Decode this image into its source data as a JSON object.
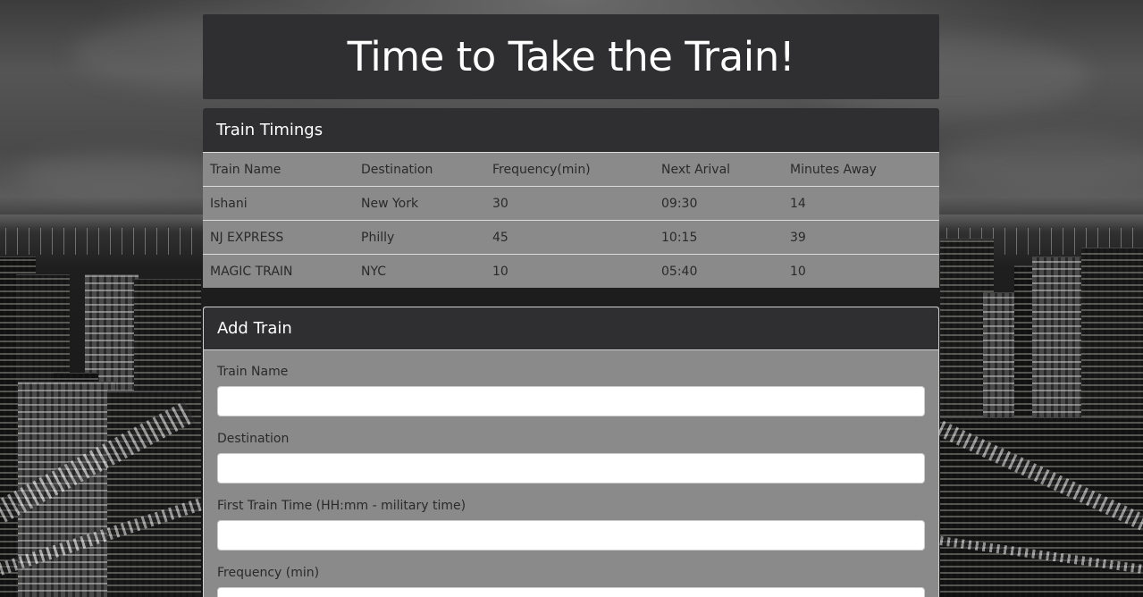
{
  "header": {
    "title": "Time to Take the Train!"
  },
  "timings_panel": {
    "title": "Train Timings",
    "columns": [
      "Train Name",
      "Destination",
      "Frequency(min)",
      "Next Arival",
      "Minutes Away"
    ],
    "rows": [
      [
        "Ishani",
        "New York",
        "30",
        "09:30",
        "14"
      ],
      [
        "NJ EXPRESS",
        "Philly",
        "45",
        "10:15",
        "39"
      ],
      [
        "MAGIC TRAIN",
        "NYC",
        "10",
        "05:40",
        "10"
      ]
    ]
  },
  "add_panel": {
    "title": "Add Train",
    "fields": {
      "train_name": {
        "label": "Train Name",
        "value": ""
      },
      "destination": {
        "label": "Destination",
        "value": ""
      },
      "first_time": {
        "label": "First Train Time (HH:mm - military time)",
        "value": ""
      },
      "frequency": {
        "label": "Frequency (min)",
        "value": ""
      }
    }
  },
  "colors": {
    "panel_heading": "#2f2f31",
    "panel_body": "#8a8a8a",
    "heading_text": "#ffffff",
    "body_text": "#2a2a2a"
  }
}
